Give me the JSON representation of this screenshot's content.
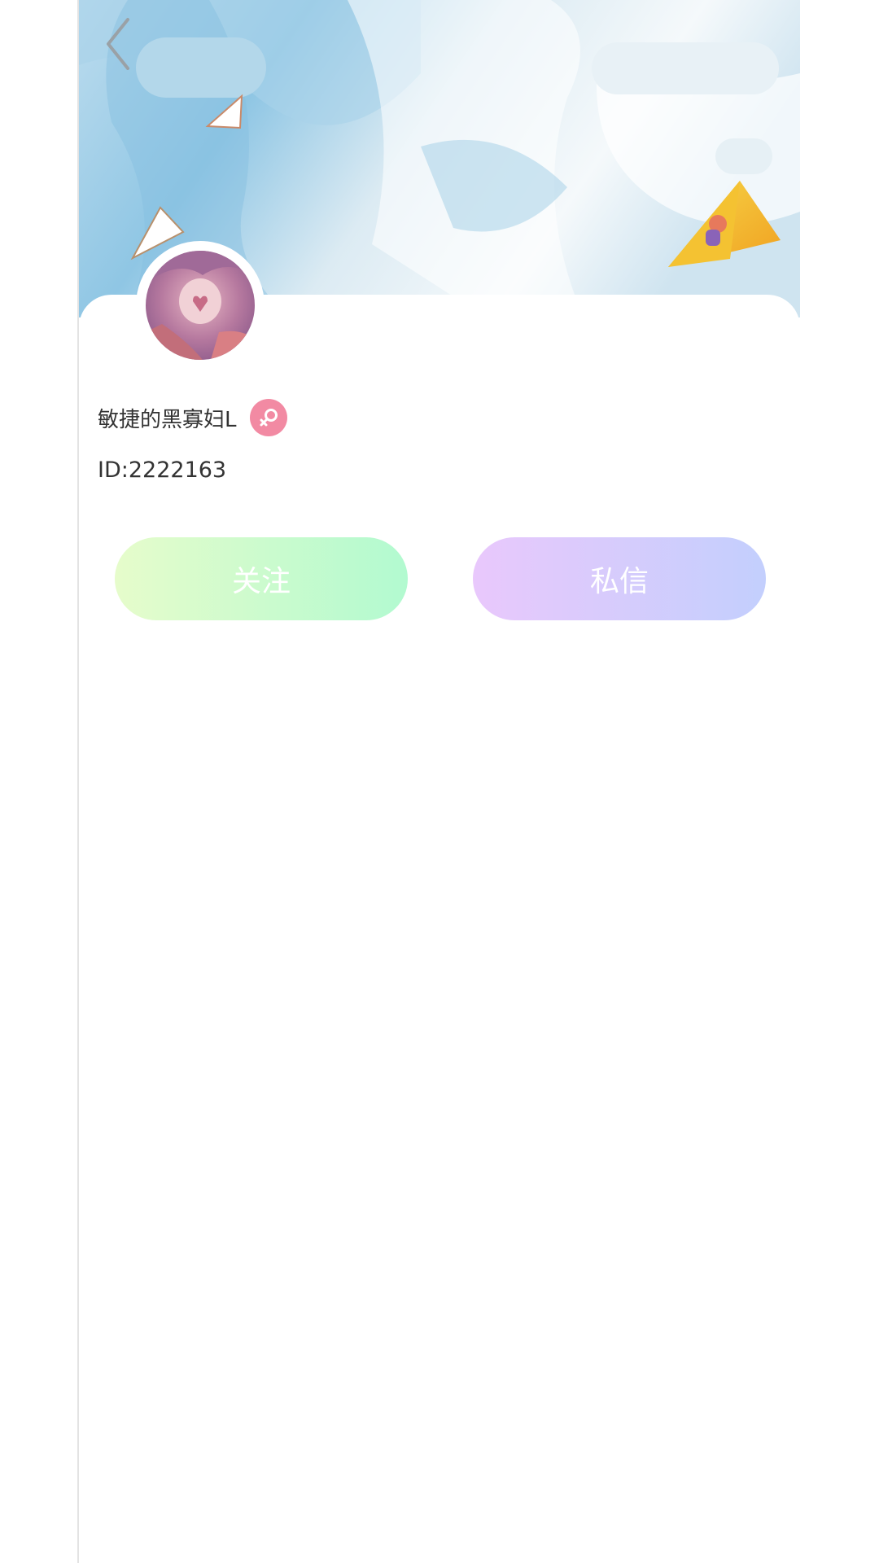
{
  "header": {
    "back_icon": "chevron-left-icon"
  },
  "profile": {
    "nickname": "敏捷的黑寡妇L",
    "gender_icon": "female-icon",
    "user_id": "ID:2222163",
    "badge_color": "#f28aa3"
  },
  "actions": {
    "follow_label": "关注",
    "message_label": "私信"
  },
  "colors": {
    "follow_gradient": [
      "#e6fccb",
      "#b2fad0"
    ],
    "message_gradient": [
      "#e9c8fc",
      "#c3cffd"
    ],
    "text": "#333333"
  }
}
